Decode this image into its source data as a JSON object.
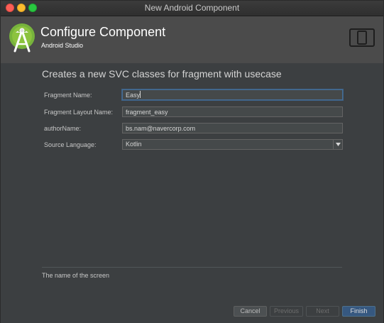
{
  "window": {
    "title": "New Android Component"
  },
  "header": {
    "title": "Configure Component",
    "subtitle": "Android Studio",
    "logo_icon": "android-studio-logo-icon",
    "device_icon": "device-layout-icon",
    "background": "#4b4b4b"
  },
  "main": {
    "heading": "Creates a new SVC classes for fragment with usecase",
    "fields": [
      {
        "label": "Fragment Name:",
        "value": "Easy",
        "focused": true
      },
      {
        "label": "Fragment Layout Name:",
        "value": "fragment_easy"
      },
      {
        "label": "authorName:",
        "value": "bs.nam@navercorp.com"
      }
    ],
    "source_language": {
      "label": "Source Language:",
      "selected": "Kotlin"
    },
    "help_text": "The name of the screen"
  },
  "footer": {
    "cancel_label": "Cancel",
    "previous_label": "Previous",
    "next_label": "Next",
    "finish_label": "Finish",
    "accent": "#365880"
  }
}
